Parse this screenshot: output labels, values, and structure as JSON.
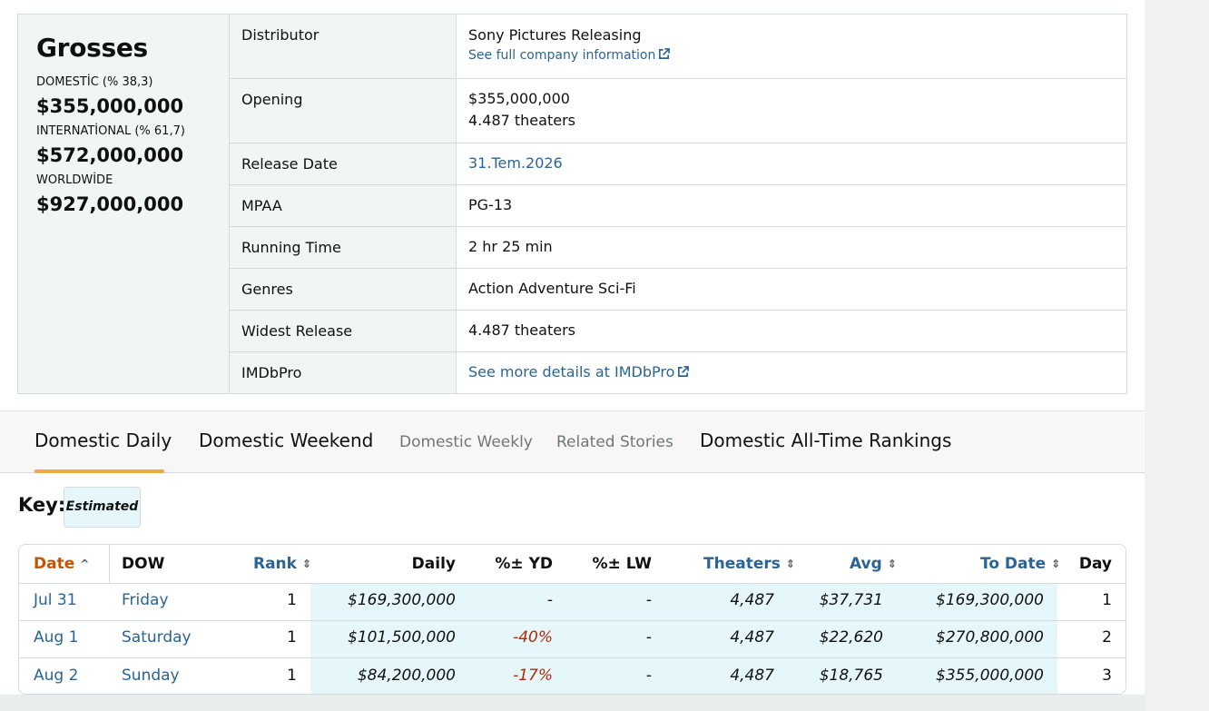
{
  "grosses": {
    "title": "Grosses",
    "domestic_label": "DOMESTİC (% 38,3)",
    "domestic_value": "$355,000,000",
    "international_label": "INTERNATİONAL (% 61,7)",
    "international_value": "$572,000,000",
    "worldwide_label": "WORLDWİDE",
    "worldwide_value": "$927,000,000"
  },
  "summary": {
    "distributor_label": "Distributor",
    "distributor_value": "Sony Pictures Releasing",
    "distributor_link": "See full company information",
    "opening_label": "Opening",
    "opening_value": "$355,000,000",
    "opening_theaters": "4.487 theaters",
    "release_label": "Release Date",
    "release_value": "31.Tem.2026",
    "mpaa_label": "MPAA",
    "mpaa_value": "PG-13",
    "runtime_label": "Running Time",
    "runtime_value": "2 hr 25 min",
    "genres_label": "Genres",
    "genres_value": "Action Adventure Sci-Fi",
    "widest_label": "Widest Release",
    "widest_value": "4.487 theaters",
    "imdbpro_label": "IMDbPro",
    "imdbpro_link": "See more details at IMDbPro"
  },
  "tabs": {
    "daily": "Domestic Daily",
    "weekend": "Domestic Weekend",
    "weekly": "Domestic Weekly",
    "stories": "Related Stories",
    "rankings": "Domestic All-Time Rankings"
  },
  "key": {
    "label": "Key:",
    "badge": "Estimated"
  },
  "table": {
    "headers": {
      "date": "Date",
      "dow": "DOW",
      "rank": "Rank",
      "daily": "Daily",
      "yd": "%± YD",
      "lw": "%± LW",
      "theaters": "Theaters",
      "avg": "Avg",
      "todate": "To Date",
      "day": "Day"
    },
    "rows": [
      {
        "date": "Jul 31",
        "dow": "Friday",
        "rank": "1",
        "daily": "$169,300,000",
        "yd": "-",
        "lw": "-",
        "theaters": "4,487",
        "avg": "$37,731",
        "todate": "$169,300,000",
        "day": "1"
      },
      {
        "date": "Aug 1",
        "dow": "Saturday",
        "rank": "1",
        "daily": "$101,500,000",
        "yd": "-40%",
        "lw": "-",
        "theaters": "4,487",
        "avg": "$22,620",
        "todate": "$270,800,000",
        "day": "2"
      },
      {
        "date": "Aug 2",
        "dow": "Sunday",
        "rank": "1",
        "daily": "$84,200,000",
        "yd": "-17%",
        "lw": "-",
        "theaters": "4,487",
        "avg": "$18,765",
        "todate": "$355,000,000",
        "day": "3"
      }
    ]
  },
  "colors": {
    "link": "#2a6496",
    "active_sort": "#c45500",
    "negative": "#b12704",
    "tab_underline": "#f0a843",
    "highlight": "#e6f7fc"
  }
}
